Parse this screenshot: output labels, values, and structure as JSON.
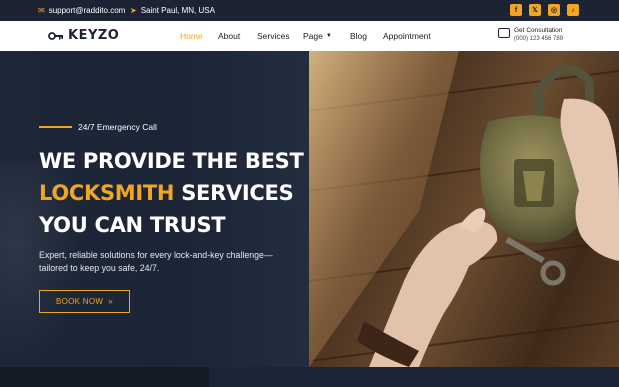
{
  "topbar": {
    "email": "support@raddito.com",
    "email_icon": "mail-icon",
    "location": "Saint Paul, MN, USA",
    "location_icon": "location-pin-icon",
    "socials": [
      "facebook-icon",
      "x-twitter-icon",
      "instagram-icon",
      "tiktok-icon"
    ],
    "social_glyphs": [
      "f",
      "𝕏",
      "◎",
      "♪"
    ]
  },
  "brand": {
    "name": "KEYZO",
    "logo_icon": "key-icon"
  },
  "nav": {
    "items": [
      {
        "label": "Home",
        "active": true
      },
      {
        "label": "About"
      },
      {
        "label": "Services"
      },
      {
        "label": "Page",
        "dropdown": true
      },
      {
        "label": "Blog"
      },
      {
        "label": "Appointment"
      }
    ]
  },
  "consultation": {
    "label": "Get Consultation",
    "phone": "(000) 123 456 789",
    "icon": "chat-icon"
  },
  "hero": {
    "eyebrow": "24/7 Emergency Call",
    "title_line1": "WE PROVIDE THE BEST",
    "title_accent": "LOCKSMITH",
    "title_line2_rest": " SERVICES",
    "title_line3": "YOU CAN TRUST",
    "description": "Expert, reliable solutions for every lock-and-key challenge—tailored to keep you safe, 24/7.",
    "cta_label": "BOOK NOW",
    "cta_icon": "double-chevron-right-icon",
    "image_alt": "hands-opening-padlock-photo"
  },
  "colors": {
    "accent": "#f0a623",
    "dark": "#1b2535",
    "white": "#ffffff"
  }
}
